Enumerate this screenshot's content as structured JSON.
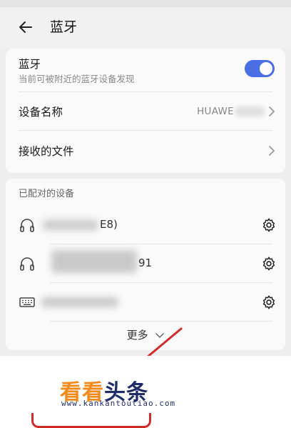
{
  "header": {
    "title": "蓝牙"
  },
  "bluetooth": {
    "label": "蓝牙",
    "sublabel": "当前可被附近的蓝牙设备发现",
    "enabled": true
  },
  "device_name": {
    "label": "设备名称",
    "value": "HUAWE"
  },
  "received_files": {
    "label": "接收的文件"
  },
  "paired": {
    "section_label": "已配对的设备",
    "devices": [
      {
        "icon": "headphones-icon",
        "name_suffix": "E8)"
      },
      {
        "icon": "headphones-icon",
        "name_suffix": "91"
      },
      {
        "icon": "keyboard-icon",
        "name_suffix": ""
      }
    ],
    "more_label": "更多"
  },
  "watermark": {
    "brand_orange": "看看",
    "brand_blue": "头条",
    "url": "www.kankantoutiao.com"
  },
  "colors": {
    "accent": "#4a6fe3",
    "annotation_red": "#d22a2a",
    "brand_orange": "#f28a1b",
    "brand_blue": "#1f2d6b"
  }
}
